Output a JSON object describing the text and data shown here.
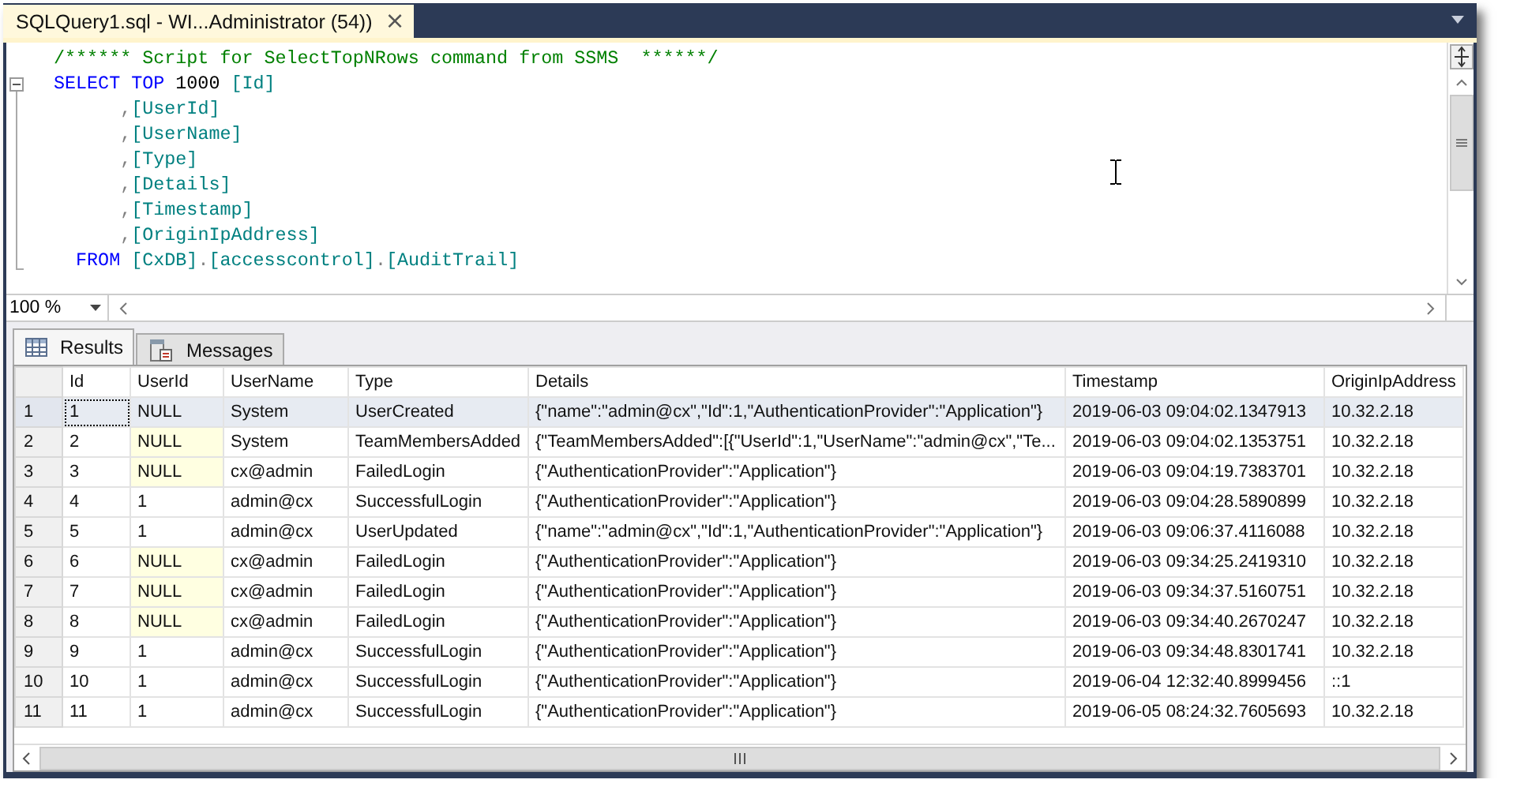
{
  "document_tab": {
    "title": "SQLQuery1.sql - WI...Administrator (54))",
    "close": "×",
    "selected": true
  },
  "editor": {
    "lines": [
      {
        "tokens": [
          {
            "kind": "comment",
            "text": "/****** Script for SelectTopNRows command from SSMS  ******/"
          }
        ]
      },
      {
        "tokens": [
          {
            "kind": "keyword",
            "text": "SELECT TOP "
          },
          {
            "kind": "number",
            "text": "1000 "
          },
          {
            "kind": "ident",
            "text": "[Id]"
          }
        ]
      },
      {
        "tokens": [
          {
            "kind": "punct",
            "text": "      ,"
          },
          {
            "kind": "ident",
            "text": "[UserId]"
          }
        ]
      },
      {
        "tokens": [
          {
            "kind": "punct",
            "text": "      ,"
          },
          {
            "kind": "ident",
            "text": "[UserName]"
          }
        ]
      },
      {
        "tokens": [
          {
            "kind": "punct",
            "text": "      ,"
          },
          {
            "kind": "ident",
            "text": "[Type]"
          }
        ]
      },
      {
        "tokens": [
          {
            "kind": "punct",
            "text": "      ,"
          },
          {
            "kind": "ident",
            "text": "[Details]"
          }
        ]
      },
      {
        "tokens": [
          {
            "kind": "punct",
            "text": "      ,"
          },
          {
            "kind": "ident",
            "text": "[Timestamp]"
          }
        ]
      },
      {
        "tokens": [
          {
            "kind": "punct",
            "text": "      ,"
          },
          {
            "kind": "ident",
            "text": "[OriginIpAddress]"
          }
        ]
      },
      {
        "tokens": [
          {
            "kind": "keyword",
            "text": "  FROM "
          },
          {
            "kind": "ident",
            "text": "[CxDB]"
          },
          {
            "kind": "punct",
            "text": "."
          },
          {
            "kind": "ident",
            "text": "[accesscontrol]"
          },
          {
            "kind": "punct",
            "text": "."
          },
          {
            "kind": "ident",
            "text": "[AuditTrail]"
          }
        ]
      }
    ]
  },
  "zoom": {
    "value": "100 %"
  },
  "result_tabs": [
    {
      "label": "Results",
      "kind": "grid",
      "selected": true
    },
    {
      "label": "Messages",
      "kind": "messages",
      "selected": false
    }
  ],
  "table": {
    "columns": [
      "Id",
      "UserId",
      "UserName",
      "Type",
      "Details",
      "Timestamp",
      "OriginIpAddress"
    ],
    "rows": [
      {
        "row_number": "1",
        "selected": true,
        "focused": true,
        "user_id_null": true,
        "cells": [
          "1",
          "NULL",
          "System",
          "UserCreated",
          "{\"name\":\"admin@cx\",\"Id\":1,\"AuthenticationProvider\":\"Application\"}",
          "2019-06-03 09:04:02.1347913",
          "10.32.2.18"
        ]
      },
      {
        "row_number": "2",
        "selected": false,
        "focused": false,
        "user_id_null": true,
        "cells": [
          "2",
          "NULL",
          "System",
          "TeamMembersAdded",
          "{\"TeamMembersAdded\":[{\"UserId\":1,\"UserName\":\"admin@cx\",\"Te...",
          "2019-06-03 09:04:02.1353751",
          "10.32.2.18"
        ]
      },
      {
        "row_number": "3",
        "selected": false,
        "focused": false,
        "user_id_null": true,
        "cells": [
          "3",
          "NULL",
          "cx@admin",
          "FailedLogin",
          "{\"AuthenticationProvider\":\"Application\"}",
          "2019-06-03 09:04:19.7383701",
          "10.32.2.18"
        ]
      },
      {
        "row_number": "4",
        "selected": false,
        "focused": false,
        "user_id_null": false,
        "cells": [
          "4",
          "1",
          "admin@cx",
          "SuccessfulLogin",
          "{\"AuthenticationProvider\":\"Application\"}",
          "2019-06-03 09:04:28.5890899",
          "10.32.2.18"
        ]
      },
      {
        "row_number": "5",
        "selected": false,
        "focused": false,
        "user_id_null": false,
        "cells": [
          "5",
          "1",
          "admin@cx",
          "UserUpdated",
          "{\"name\":\"admin@cx\",\"Id\":1,\"AuthenticationProvider\":\"Application\"}",
          "2019-06-03 09:06:37.4116088",
          "10.32.2.18"
        ]
      },
      {
        "row_number": "6",
        "selected": false,
        "focused": false,
        "user_id_null": true,
        "cells": [
          "6",
          "NULL",
          "cx@admin",
          "FailedLogin",
          "{\"AuthenticationProvider\":\"Application\"}",
          "2019-06-03 09:34:25.2419310",
          "10.32.2.18"
        ]
      },
      {
        "row_number": "7",
        "selected": false,
        "focused": false,
        "user_id_null": true,
        "cells": [
          "7",
          "NULL",
          "cx@admin",
          "FailedLogin",
          "{\"AuthenticationProvider\":\"Application\"}",
          "2019-06-03 09:34:37.5160751",
          "10.32.2.18"
        ]
      },
      {
        "row_number": "8",
        "selected": false,
        "focused": false,
        "user_id_null": true,
        "cells": [
          "8",
          "NULL",
          "cx@admin",
          "FailedLogin",
          "{\"AuthenticationProvider\":\"Application\"}",
          "2019-06-03 09:34:40.2670247",
          "10.32.2.18"
        ]
      },
      {
        "row_number": "9",
        "selected": false,
        "focused": false,
        "user_id_null": false,
        "cells": [
          "9",
          "1",
          "admin@cx",
          "SuccessfulLogin",
          "{\"AuthenticationProvider\":\"Application\"}",
          "2019-06-03 09:34:48.8301741",
          "10.32.2.18"
        ]
      },
      {
        "row_number": "10",
        "selected": false,
        "focused": false,
        "user_id_null": false,
        "cells": [
          "10",
          "1",
          "admin@cx",
          "SuccessfulLogin",
          "{\"AuthenticationProvider\":\"Application\"}",
          "2019-06-04 12:32:40.8999456",
          "::1"
        ]
      },
      {
        "row_number": "11",
        "selected": false,
        "focused": false,
        "user_id_null": false,
        "cells": [
          "11",
          "1",
          "admin@cx",
          "SuccessfulLogin",
          "{\"AuthenticationProvider\":\"Application\"}",
          "2019-06-05 08:24:32.7605693",
          "10.32.2.18"
        ]
      }
    ]
  }
}
